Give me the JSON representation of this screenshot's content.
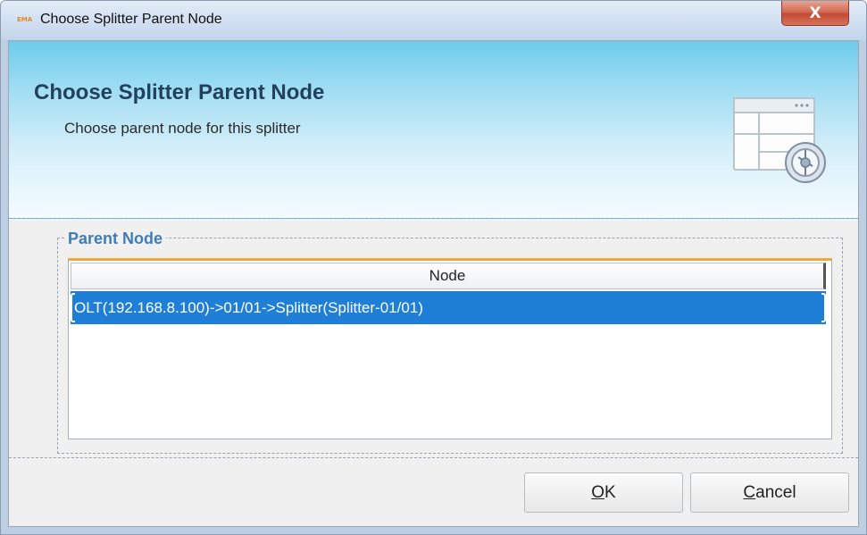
{
  "window": {
    "app_icon_text": "EMA",
    "title": "Choose Splitter Parent Node",
    "close_glyph": "X"
  },
  "banner": {
    "title": "Choose Splitter Parent Node",
    "subtitle": "Choose parent node for this splitter",
    "icon": "window-layout-settings-icon"
  },
  "group": {
    "label": "Parent Node",
    "table": {
      "columns": [
        "Node"
      ],
      "rows": [
        {
          "node": "OLT(192.168.8.100)->01/01->Splitter(Splitter-01/01)",
          "selected": true
        }
      ]
    }
  },
  "buttons": {
    "ok_mnemonic": "O",
    "ok_rest": "K",
    "cancel_mnemonic": "C",
    "cancel_rest": "ancel"
  },
  "colors": {
    "selection": "#1f7fd6",
    "group_label": "#3f7db7",
    "banner_title": "#22415f",
    "header_accent": "#f0a93a"
  }
}
